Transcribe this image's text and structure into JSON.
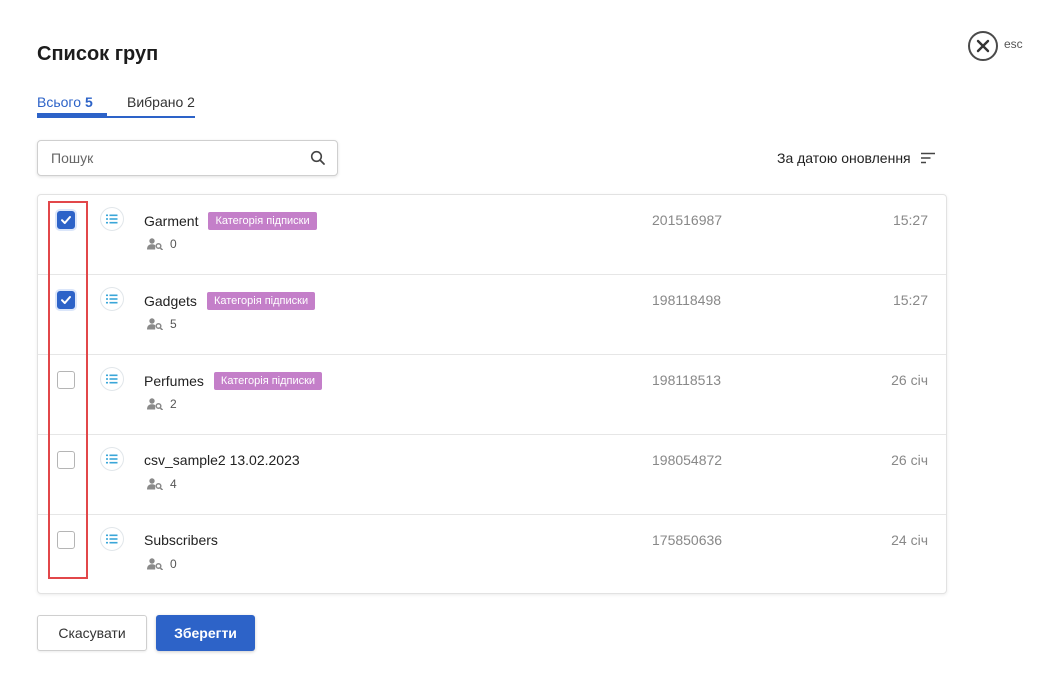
{
  "header": {
    "title": "Список груп",
    "close_label": "esc"
  },
  "tabs": {
    "all_label": "Всього",
    "all_count": "5",
    "selected_label": "Вибрано 2"
  },
  "search": {
    "placeholder": "Пошук",
    "value": ""
  },
  "sort": {
    "label": "За датою оновлення"
  },
  "groups": [
    {
      "name": "Garment",
      "tag": "Категорія підписки",
      "members": "0",
      "id": "201516987",
      "date": "15:27",
      "checked": true
    },
    {
      "name": "Gadgets",
      "tag": "Категорія підписки",
      "members": "5",
      "id": "198118498",
      "date": "15:27",
      "checked": true
    },
    {
      "name": "Perfumes",
      "tag": "Категорія підписки",
      "members": "2",
      "id": "198118513",
      "date": "26 січ",
      "checked": false
    },
    {
      "name": "csv_sample2 13.02.2023",
      "tag": "",
      "members": "4",
      "id": "198054872",
      "date": "26 січ",
      "checked": false
    },
    {
      "name": "Subscribers",
      "tag": "",
      "members": "0",
      "id": "175850636",
      "date": "24 січ",
      "checked": false
    }
  ],
  "footer": {
    "cancel_label": "Скасувати",
    "save_label": "Зберегти"
  },
  "colors": {
    "accent": "#2d63c8",
    "tag": "#c47fc9",
    "highlight": "#e2474a"
  },
  "icons": {
    "close": "close-circle-icon",
    "search": "search-icon",
    "sort": "sort-lines-icon",
    "list": "list-icon",
    "members": "user-search-icon",
    "check": "check-icon"
  }
}
